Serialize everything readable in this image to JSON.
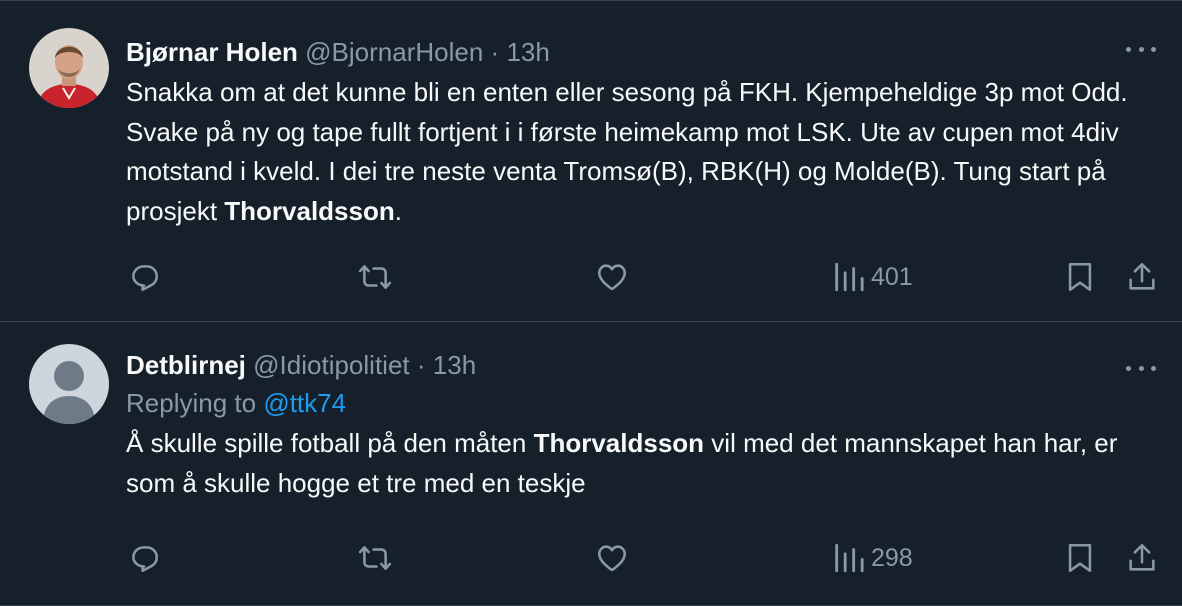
{
  "tweets": [
    {
      "name": "Bjørnar Holen",
      "handle": "@BjornarHolen",
      "separator": "·",
      "time": "13h",
      "replying_label": "",
      "replying_to": "",
      "text_parts": [
        "Snakka om at det kunne bli en enten eller sesong på FKH. Kjempeheldige 3p mot Odd. Svake på ny og tape fullt fortjent i i første heimekamp mot LSK. Ute av cupen mot 4div motstand i kveld. I dei tre neste venta Tromsø(B), RBK(H) og Molde(B). Tung start på prosjekt ",
        "Thorvaldsson",
        "."
      ],
      "views": "401"
    },
    {
      "name": "Detblirnej",
      "handle": "@Idiotipolitiet",
      "separator": "·",
      "time": "13h",
      "replying_label": "Replying to",
      "replying_to": "@ttk74",
      "text_parts": [
        "Å skulle spille fotball på den måten ",
        "Thorvaldsson",
        " vil med det mannskapet han har, er som å skulle hogge et tre med en teskje"
      ],
      "views": "298"
    }
  ],
  "icons": [
    "reply-icon",
    "retweet-icon",
    "like-icon",
    "views-icon",
    "bookmark-icon",
    "share-icon",
    "more-icon"
  ],
  "colors": {
    "background": "#15202b",
    "text": "#f7f9f9",
    "muted": "#8b98a5",
    "link": "#1d9bf0",
    "divider": "#38444d"
  }
}
